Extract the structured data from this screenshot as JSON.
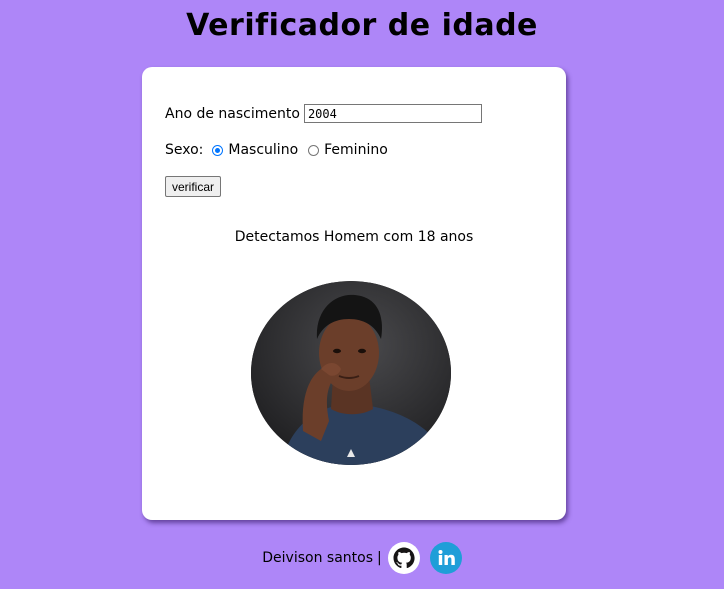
{
  "page": {
    "title": "Verificador de idade"
  },
  "form": {
    "year_label": "Ano de nascimento",
    "year_value": "2004",
    "sex_label": "Sexo:",
    "options": [
      {
        "label": "Masculino",
        "checked": true
      },
      {
        "label": "Feminino",
        "checked": false
      }
    ],
    "button_label": "verificar"
  },
  "result": {
    "text": "Detectamos Homem com 18 anos",
    "image_icon": "male-portrait-photo"
  },
  "footer": {
    "author": "Deivison santos",
    "separator": "|",
    "github_icon": "github-icon",
    "linkedin_icon": "linkedin-icon"
  },
  "colors": {
    "background": "#ae86f8",
    "card": "#ffffff",
    "radio_accent": "#0075ff",
    "linkedin": "#1e9ed8"
  }
}
